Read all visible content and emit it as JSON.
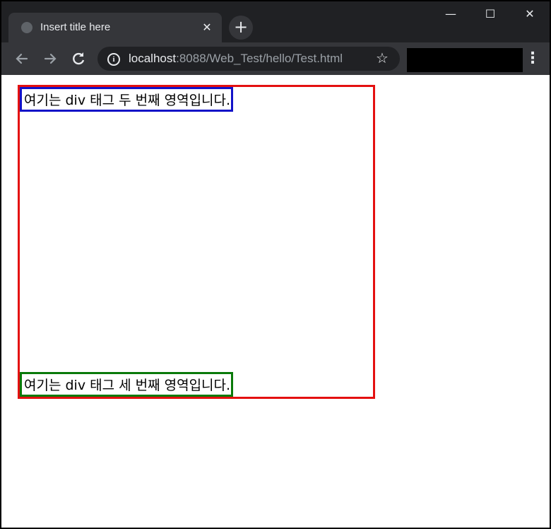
{
  "browser": {
    "tab_title": "Insert title here",
    "tab_close": "✕",
    "new_tab": "+",
    "url_host": "localhost",
    "url_rest": ":8088/Web_Test/hello/Test.html",
    "icons": {
      "favicon": "globe-icon",
      "back": "back-arrow-icon",
      "forward": "forward-arrow-icon",
      "reload": "reload-icon",
      "info": "info-icon",
      "bookmark": "star-icon",
      "menu": "kebab-menu-icon"
    },
    "window_controls": {
      "minimize": "—",
      "maximize": "☐",
      "close": "✕"
    }
  },
  "page": {
    "second_div_text": "여기는 div 태그 두 번째 영역입니다.",
    "third_div_text": "여기는 div 태그 세 번째 영역입니다.",
    "colors": {
      "first_border": "#e41010",
      "second_border": "#1212c8",
      "third_border": "#0a7a0a"
    }
  }
}
